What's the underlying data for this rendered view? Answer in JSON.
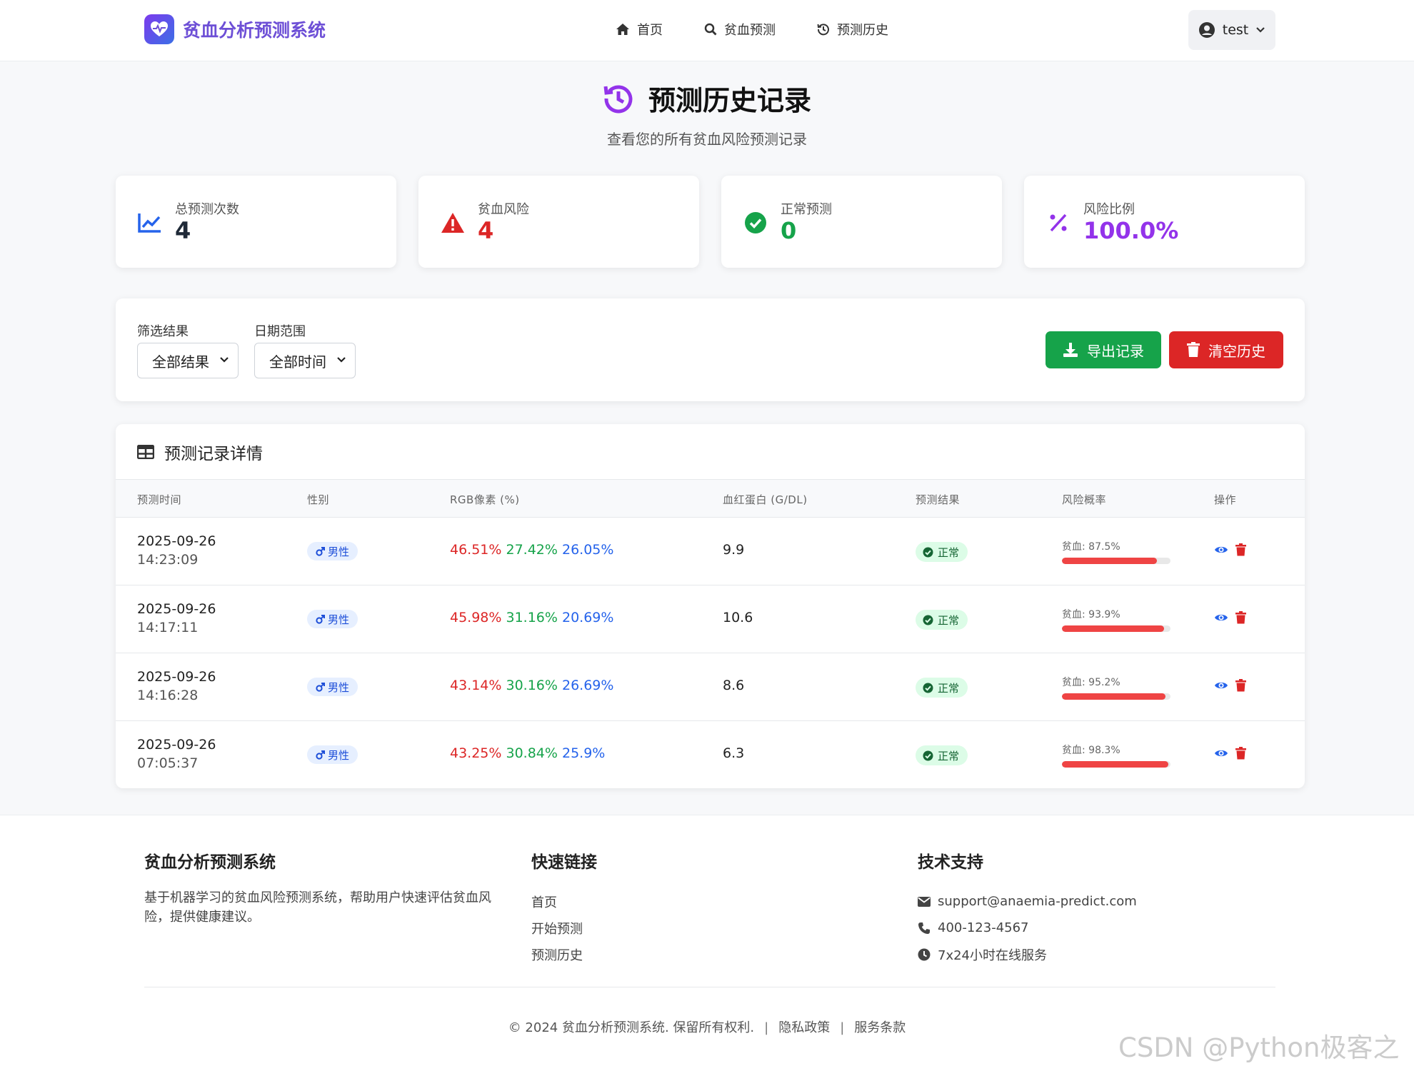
{
  "nav": {
    "brand": "贫血分析预测系统",
    "links": [
      {
        "label": "首页",
        "icon": "home-icon"
      },
      {
        "label": "贫血预测",
        "icon": "search-icon"
      },
      {
        "label": "预测历史",
        "icon": "history-icon"
      }
    ],
    "user": "test"
  },
  "header": {
    "title": "预测历史记录",
    "subtitle": "查看您的所有贫血风险预测记录"
  },
  "stats": [
    {
      "label": "总预测次数",
      "value": "4",
      "color": "#1f2937",
      "icon": "chart-line-icon"
    },
    {
      "label": "贫血风险",
      "value": "4",
      "color": "#dc2626",
      "icon": "warning-icon"
    },
    {
      "label": "正常预测",
      "value": "0",
      "color": "#16a34a",
      "icon": "check-circle-icon"
    },
    {
      "label": "风险比例",
      "value": "100.0%",
      "color": "#9333ea",
      "icon": "percent-icon"
    }
  ],
  "filters": {
    "result_label": "筛选结果",
    "result_value": "全部结果",
    "date_label": "日期范围",
    "date_value": "全部时间",
    "export_label": "导出记录",
    "clear_label": "清空历史"
  },
  "table": {
    "title": "预测记录详情",
    "columns": [
      "预测时间",
      "性别",
      "RGB像素 (%)",
      "血红蛋白 (G/DL)",
      "预测结果",
      "风险概率",
      "操作"
    ],
    "rows": [
      {
        "date": "2025-09-26",
        "time": "14:23:09",
        "gender": "男性",
        "r": "46.51%",
        "g": "27.42%",
        "b": "26.05%",
        "hb": "9.9",
        "result": "正常",
        "risk": "贫血: 87.5%",
        "risk_pct": 87.5
      },
      {
        "date": "2025-09-26",
        "time": "14:17:11",
        "gender": "男性",
        "r": "45.98%",
        "g": "31.16%",
        "b": "20.69%",
        "hb": "10.6",
        "result": "正常",
        "risk": "贫血: 93.9%",
        "risk_pct": 93.9
      },
      {
        "date": "2025-09-26",
        "time": "14:16:28",
        "gender": "男性",
        "r": "43.14%",
        "g": "30.16%",
        "b": "26.69%",
        "hb": "8.6",
        "result": "正常",
        "risk": "贫血: 95.2%",
        "risk_pct": 95.2
      },
      {
        "date": "2025-09-26",
        "time": "07:05:37",
        "gender": "男性",
        "r": "43.25%",
        "g": "30.84%",
        "b": "25.9%",
        "hb": "6.3",
        "result": "正常",
        "risk": "贫血: 98.3%",
        "risk_pct": 98.3
      }
    ]
  },
  "footer": {
    "about_title": "贫血分析预测系统",
    "about_text": "基于机器学习的贫血风险预测系统，帮助用户快速评估贫血风险，提供健康建议。",
    "links_title": "快速链接",
    "links": [
      "首页",
      "开始预测",
      "预测历史"
    ],
    "support_title": "技术支持",
    "support": [
      {
        "text": "support@anaemia-predict.com",
        "icon": "envelope-icon"
      },
      {
        "text": "400-123-4567",
        "icon": "phone-icon"
      },
      {
        "text": "7x24小时在线服务",
        "icon": "clock-icon"
      }
    ],
    "copyright": "© 2024 贫血分析预测系统. 保留所有权利.",
    "privacy": "隐私政策",
    "terms": "服务条款"
  },
  "watermark": "CSDN @Python极客之家"
}
